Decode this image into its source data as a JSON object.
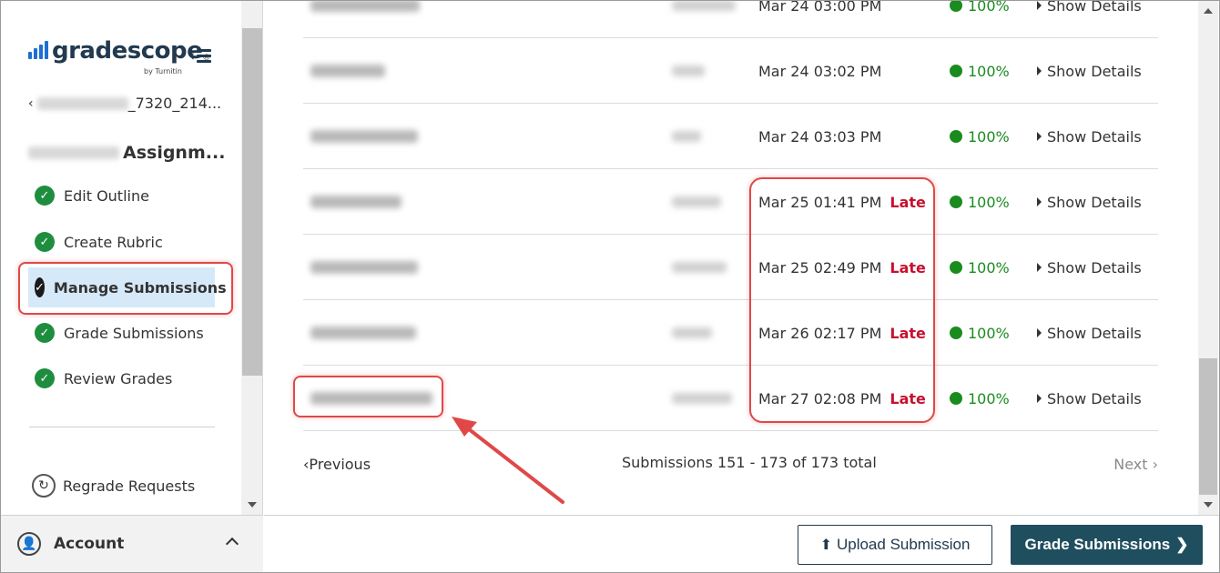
{
  "sidebar": {
    "logo_text": "gradescope",
    "logo_sub": "by Turnitin",
    "course_suffix": "_7320_214...",
    "assignment_suffix": "Assignm...",
    "nav": [
      {
        "label": "Edit Outline"
      },
      {
        "label": "Create Rubric"
      },
      {
        "label": "Manage Submissions"
      },
      {
        "label": "Grade Submissions"
      },
      {
        "label": "Review Grades"
      }
    ],
    "regrade_label": "Regrade Requests",
    "account_label": "Account"
  },
  "submissions": {
    "rows": [
      {
        "date": "Mar 24 03:00 PM",
        "late": "",
        "score": "100%",
        "details": "Show Details"
      },
      {
        "date": "Mar 24 03:02 PM",
        "late": "",
        "score": "100%",
        "details": "Show Details"
      },
      {
        "date": "Mar 24 03:03 PM",
        "late": "",
        "score": "100%",
        "details": "Show Details"
      },
      {
        "date": "Mar 25 01:41 PM",
        "late": "Late",
        "score": "100%",
        "details": "Show Details"
      },
      {
        "date": "Mar 25 02:49 PM",
        "late": "Late",
        "score": "100%",
        "details": "Show Details"
      },
      {
        "date": "Mar 26 02:17 PM",
        "late": "Late",
        "score": "100%",
        "details": "Show Details"
      },
      {
        "date": "Mar 27 02:08 PM",
        "late": "Late",
        "score": "100%",
        "details": "Show Details"
      }
    ]
  },
  "pager": {
    "previous": "Previous",
    "count": "Submissions 151 - 173 of 173 total",
    "next": "Next"
  },
  "actions": {
    "upload": "Upload Submission",
    "grade": "Grade Submissions"
  },
  "colors": {
    "late": "#c8102e",
    "success": "#1a8c1f",
    "primary": "#1f4e5f",
    "annotation": "#e04848"
  }
}
